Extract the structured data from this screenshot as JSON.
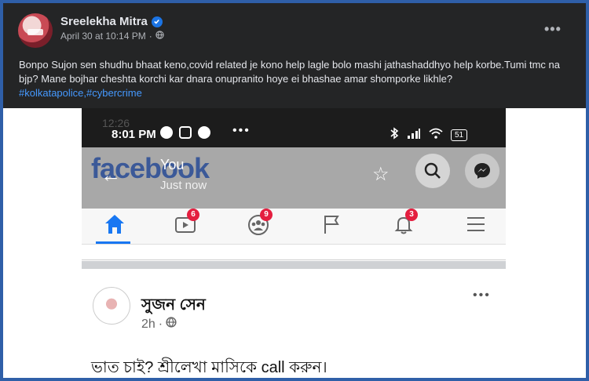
{
  "post": {
    "author": "Sreelekha Mitra",
    "timestamp": "April 30 at 10:14 PM",
    "separator": "·",
    "text": "Bonpo Sujon sen shudhu bhaat keno,covid related je kono help lagle bolo mashi jathashaddhyo help korbe.Tumi tmc na bjp? Mane bojhar cheshta korchi kar dnara onupranito hoye ei bhashae amar shomporke likhle?",
    "hashtags": "#kolkatapolice,#cybercrime",
    "more_label": "•••"
  },
  "phone": {
    "ghost_time": "12:26",
    "status_time": "8:01 PM",
    "status_more": "•••",
    "battery": "51",
    "fb_logo": "facebook",
    "chat_title": "You",
    "chat_subtitle": "Just now",
    "nav_badges": {
      "video": "6",
      "groups": "9",
      "notifications": "3"
    },
    "inner_post": {
      "author": "সুজন সেন",
      "time": "2h",
      "separator": "·",
      "text": "ভাত চাই? শ্রীলেখা মাসিকে call করুন।",
      "more_label": "•••"
    }
  },
  "colors": {
    "frame_border": "#2f5fa8",
    "dark_bg": "#242526",
    "hashtag": "#4599ff",
    "fb_blue": "#1877f2",
    "badge": "#e41e3f"
  },
  "icons": [
    "verified-icon",
    "globe-icon",
    "whatsapp-icon",
    "instagram-icon",
    "facebook-icon",
    "bluetooth-icon",
    "signal-icon",
    "wifi-icon",
    "battery-icon",
    "back-arrow-icon",
    "star-icon",
    "search-icon",
    "messenger-icon",
    "home-icon",
    "video-icon",
    "groups-icon",
    "flag-icon",
    "bell-icon",
    "menu-icon"
  ]
}
